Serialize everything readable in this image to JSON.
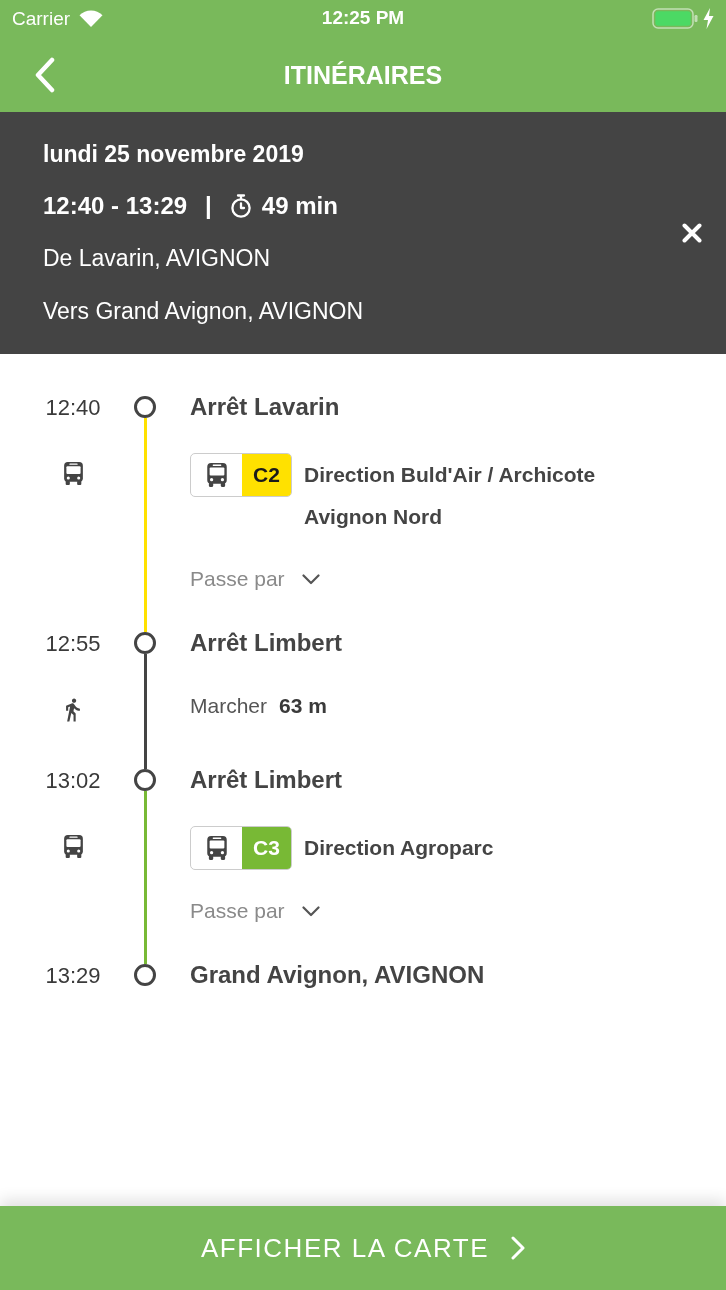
{
  "status_bar": {
    "carrier": "Carrier",
    "time": "12:25 PM"
  },
  "nav_bar": {
    "title": "ITINÉRAIRES"
  },
  "summary": {
    "date": "lundi 25 novembre 2019",
    "time_range": "12:40 - 13:29",
    "separator": "|",
    "duration": "49 min",
    "from": "De Lavarin, AVIGNON",
    "to": "Vers Grand Avignon, AVIGNON"
  },
  "itinerary": [
    {
      "kind": "stop",
      "time": "12:40",
      "name": "Arrêt Lavarin"
    },
    {
      "kind": "bus",
      "color": "#ffe100",
      "line": "C2",
      "direction": "Direction Buld'Air / Archicote Avignon Nord",
      "via": "Passe par",
      "expanded": false
    },
    {
      "kind": "stop",
      "time": "12:55",
      "name": "Arrêt Limbert"
    },
    {
      "kind": "walk",
      "color": "#444444",
      "label": "Marcher",
      "distance": "63 m"
    },
    {
      "kind": "stop",
      "time": "13:02",
      "name": "Arrêt Limbert"
    },
    {
      "kind": "bus",
      "color": "#78b935",
      "line": "C3",
      "direction": "Direction Agroparc",
      "via": "Passe par",
      "expanded": false
    },
    {
      "kind": "stop",
      "time": "13:29",
      "name": "Grand Avignon, AVIGNON"
    }
  ],
  "map_button": {
    "label": "AFFICHER LA CARTE"
  }
}
